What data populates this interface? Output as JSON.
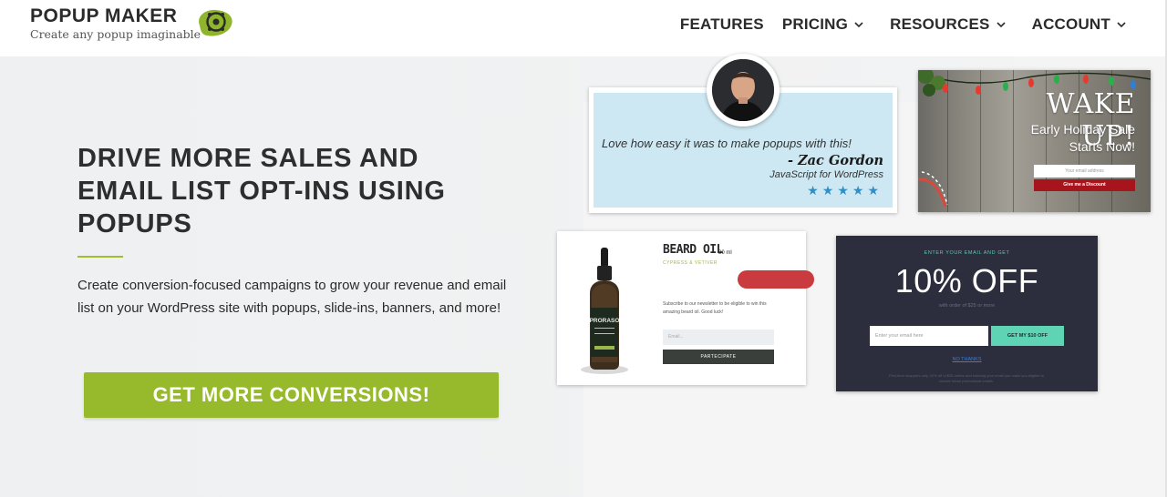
{
  "header": {
    "brand_name": "POPUP MAKER",
    "brand_tagline": "Create any popup imaginable",
    "nav": [
      {
        "label": "FEATURES",
        "dropdown": false
      },
      {
        "label": "PRICING",
        "dropdown": true
      },
      {
        "label": "RESOURCES",
        "dropdown": true
      },
      {
        "label": "ACCOUNT",
        "dropdown": true
      }
    ]
  },
  "hero": {
    "headline": "DRIVE MORE SALES AND EMAIL LIST OPT-INS USING POPUPS",
    "subcopy": "Create conversion-focused campaigns to grow your revenue and email list on your WordPress site with popups, slide-ins, banners, and more!",
    "cta_label": "GET MORE CONVERSIONS!"
  },
  "examples": {
    "testimonial": {
      "quote": "Love how easy it was to make popups with this!",
      "name": "- Zac Gordon",
      "role": "JavaScript for WordPress",
      "stars": "★★★★★"
    },
    "holiday": {
      "title": "WAKE UP!",
      "line1": "Early Holiday Sale",
      "line2": "Starts Now!",
      "input_placeholder": "Your email address",
      "button_label": "Give me a Discount"
    },
    "beard": {
      "title": "BEARD OIL",
      "size": "30 ml",
      "subtitle": "CYPRESS & VETIVER",
      "body": "Subscribe to our newsletter to be eligible to win this amazing beard oil. Good luck!",
      "input_placeholder": "Email...",
      "button_label": "PARTECIPATE",
      "bottle_label": "PRORASO"
    },
    "discount": {
      "eyebrow": "ENTER YOUR EMAIL AND GET",
      "headline": "10% OFF",
      "subline": "with order of $25 or more",
      "input_placeholder": "Enter your email here",
      "button_label": "GET MY $10 OFF",
      "decline": "NO THANKS",
      "fineprint": "First-time shoppers only. 10% off of $25 orders and entering your email you make you eligible to receive future promotional emails."
    }
  },
  "colors": {
    "accent_green": "#97ba2d",
    "text_dark": "#2b2b2b",
    "star_blue": "#2f8fc6",
    "holiday_red": "#a8141b",
    "dark_card": "#2c2e3e",
    "mint": "#5ed4b5"
  },
  "icons": {
    "logo": "popup-maker-logo-icon",
    "chevron": "chevron-down-icon",
    "star": "star-icon"
  }
}
